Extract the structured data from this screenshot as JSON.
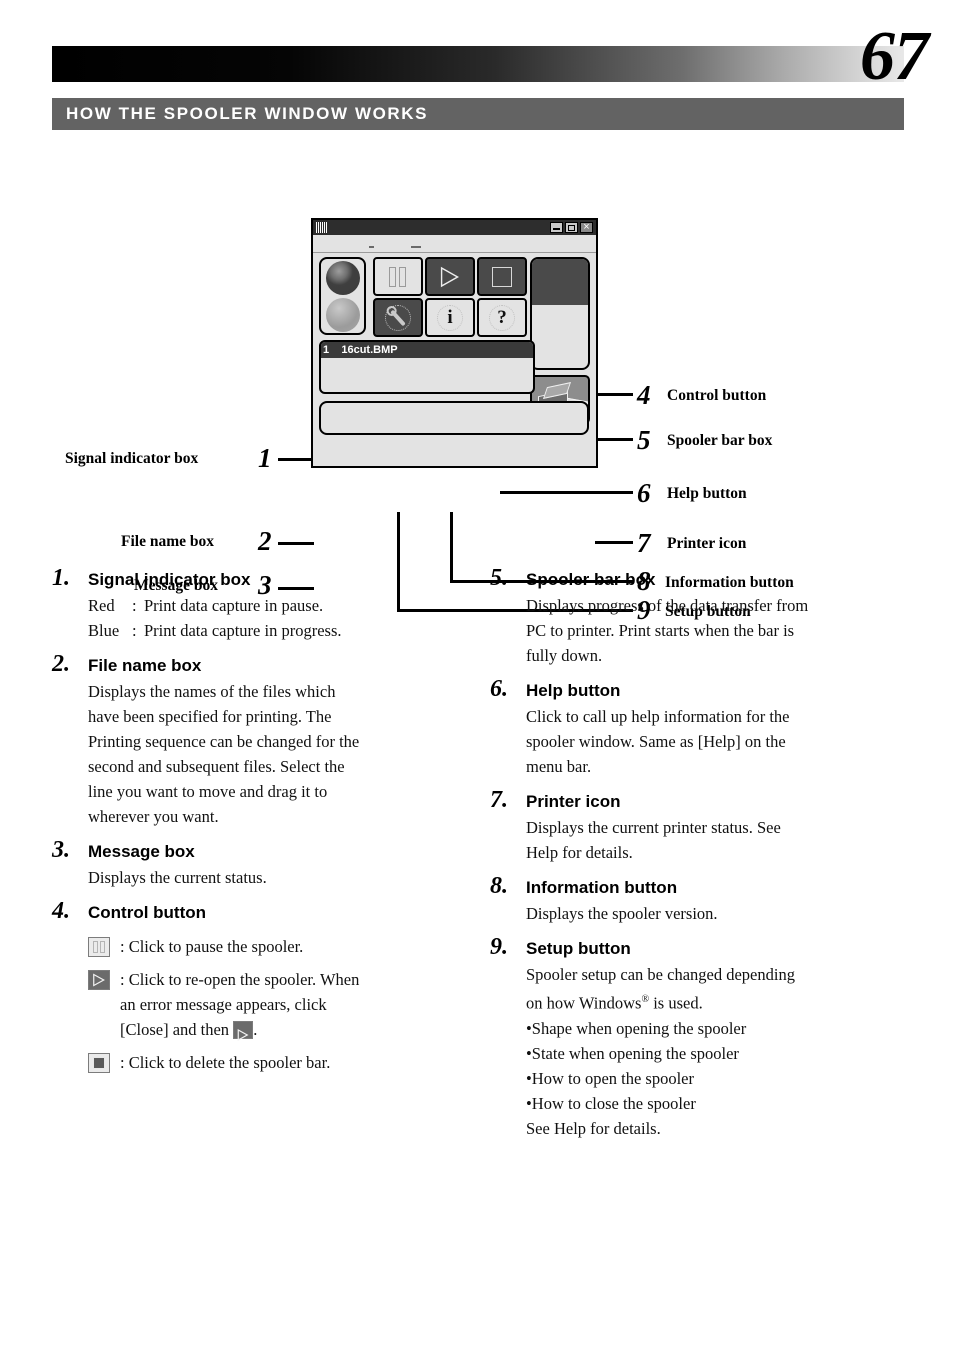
{
  "page": {
    "number": "67",
    "section_title": "HOW THE SPOOLER WINDOW WORKS"
  },
  "figure": {
    "window": {
      "file_row": "1    16cut.BMP",
      "signal_lamp_top": "dark-lamp",
      "signal_lamp_bottom": "light-lamp",
      "spooler_bar_fill_percent": 42,
      "buttons": {
        "pause": "pause-icon",
        "play": "play-icon",
        "stop": "stop-icon",
        "setup": "wrench-icon",
        "information": "i",
        "help": "?"
      },
      "window_controls": [
        "minimize",
        "maximize",
        "close"
      ]
    },
    "callouts_left": [
      {
        "num": "1",
        "label": "Signal indicator box"
      },
      {
        "num": "2",
        "label": "File name box"
      },
      {
        "num": "3",
        "label": "Message box"
      }
    ],
    "callouts_right": [
      {
        "num": "4",
        "label": "Control button"
      },
      {
        "num": "5",
        "label": "Spooler bar box"
      },
      {
        "num": "6",
        "label": "Help button"
      },
      {
        "num": "7",
        "label": "Printer icon"
      },
      {
        "num": "8",
        "label": "Information button"
      },
      {
        "num": "9",
        "label": "Setup button"
      }
    ]
  },
  "items": {
    "i1": {
      "num": "1.",
      "title": "Signal indicator box",
      "red_key": "Red",
      "red_colon": ":",
      "red_text": "Print data capture in pause.",
      "blue_key": "Blue",
      "blue_colon": ":",
      "blue_text": "Print data capture in progress."
    },
    "i2": {
      "num": "2.",
      "title": "File name box",
      "l1": "Displays the names of the files which",
      "l2": "have been specified for printing. The",
      "l3": "Printing sequence can be changed for the",
      "l4": "second and subsequent files.  Select the",
      "l5": "line you want to move and drag it to",
      "l6": "wherever you want."
    },
    "i3": {
      "num": "3.",
      "title": "Message box",
      "l1": "Displays the current status."
    },
    "i4": {
      "num": "4.",
      "title": "Control button",
      "pause_text": ": Click to pause the spooler.",
      "play_text_l1": ": Click to re-open the spooler. When",
      "play_text_l2": "an error message appears, click",
      "play_text_l3a": "[Close] and then",
      "play_text_l3b": ".",
      "stop_text": ": Click to delete the spooler bar."
    },
    "i5": {
      "num": "5.",
      "title": "Spooler bar box",
      "l1": "Displays progress of the data transfer from",
      "l2": "PC to printer. Print starts when the bar is",
      "l3": "fully down."
    },
    "i6": {
      "num": "6.",
      "title": "Help button",
      "l1": "Click to call up help information for the",
      "l2": "spooler window. Same as [Help] on the",
      "l3": "menu bar."
    },
    "i7": {
      "num": "7.",
      "title": "Printer icon",
      "l1": "Displays the current printer status.  See",
      "l2": "Help for details."
    },
    "i8": {
      "num": "8.",
      "title": "Information button",
      "l1": "Displays the spooler version."
    },
    "i9": {
      "num": "9.",
      "title": "Setup button",
      "l1": "Spooler setup can be changed depending",
      "l2a": "on how Windows",
      "l2b": "®",
      "l2c": " is used.",
      "b1": "•Shape when opening the spooler",
      "b2": "•State when opening the spooler",
      "b3": "•How to open the spooler",
      "b4": "•How to close the spooler",
      "l3": "See Help for details."
    }
  },
  "colors": {
    "section_bar": "#636363",
    "window_chrome": "#2d2d2d",
    "window_face": "#e3e3e3",
    "dark_button": "#4a4a4a"
  }
}
